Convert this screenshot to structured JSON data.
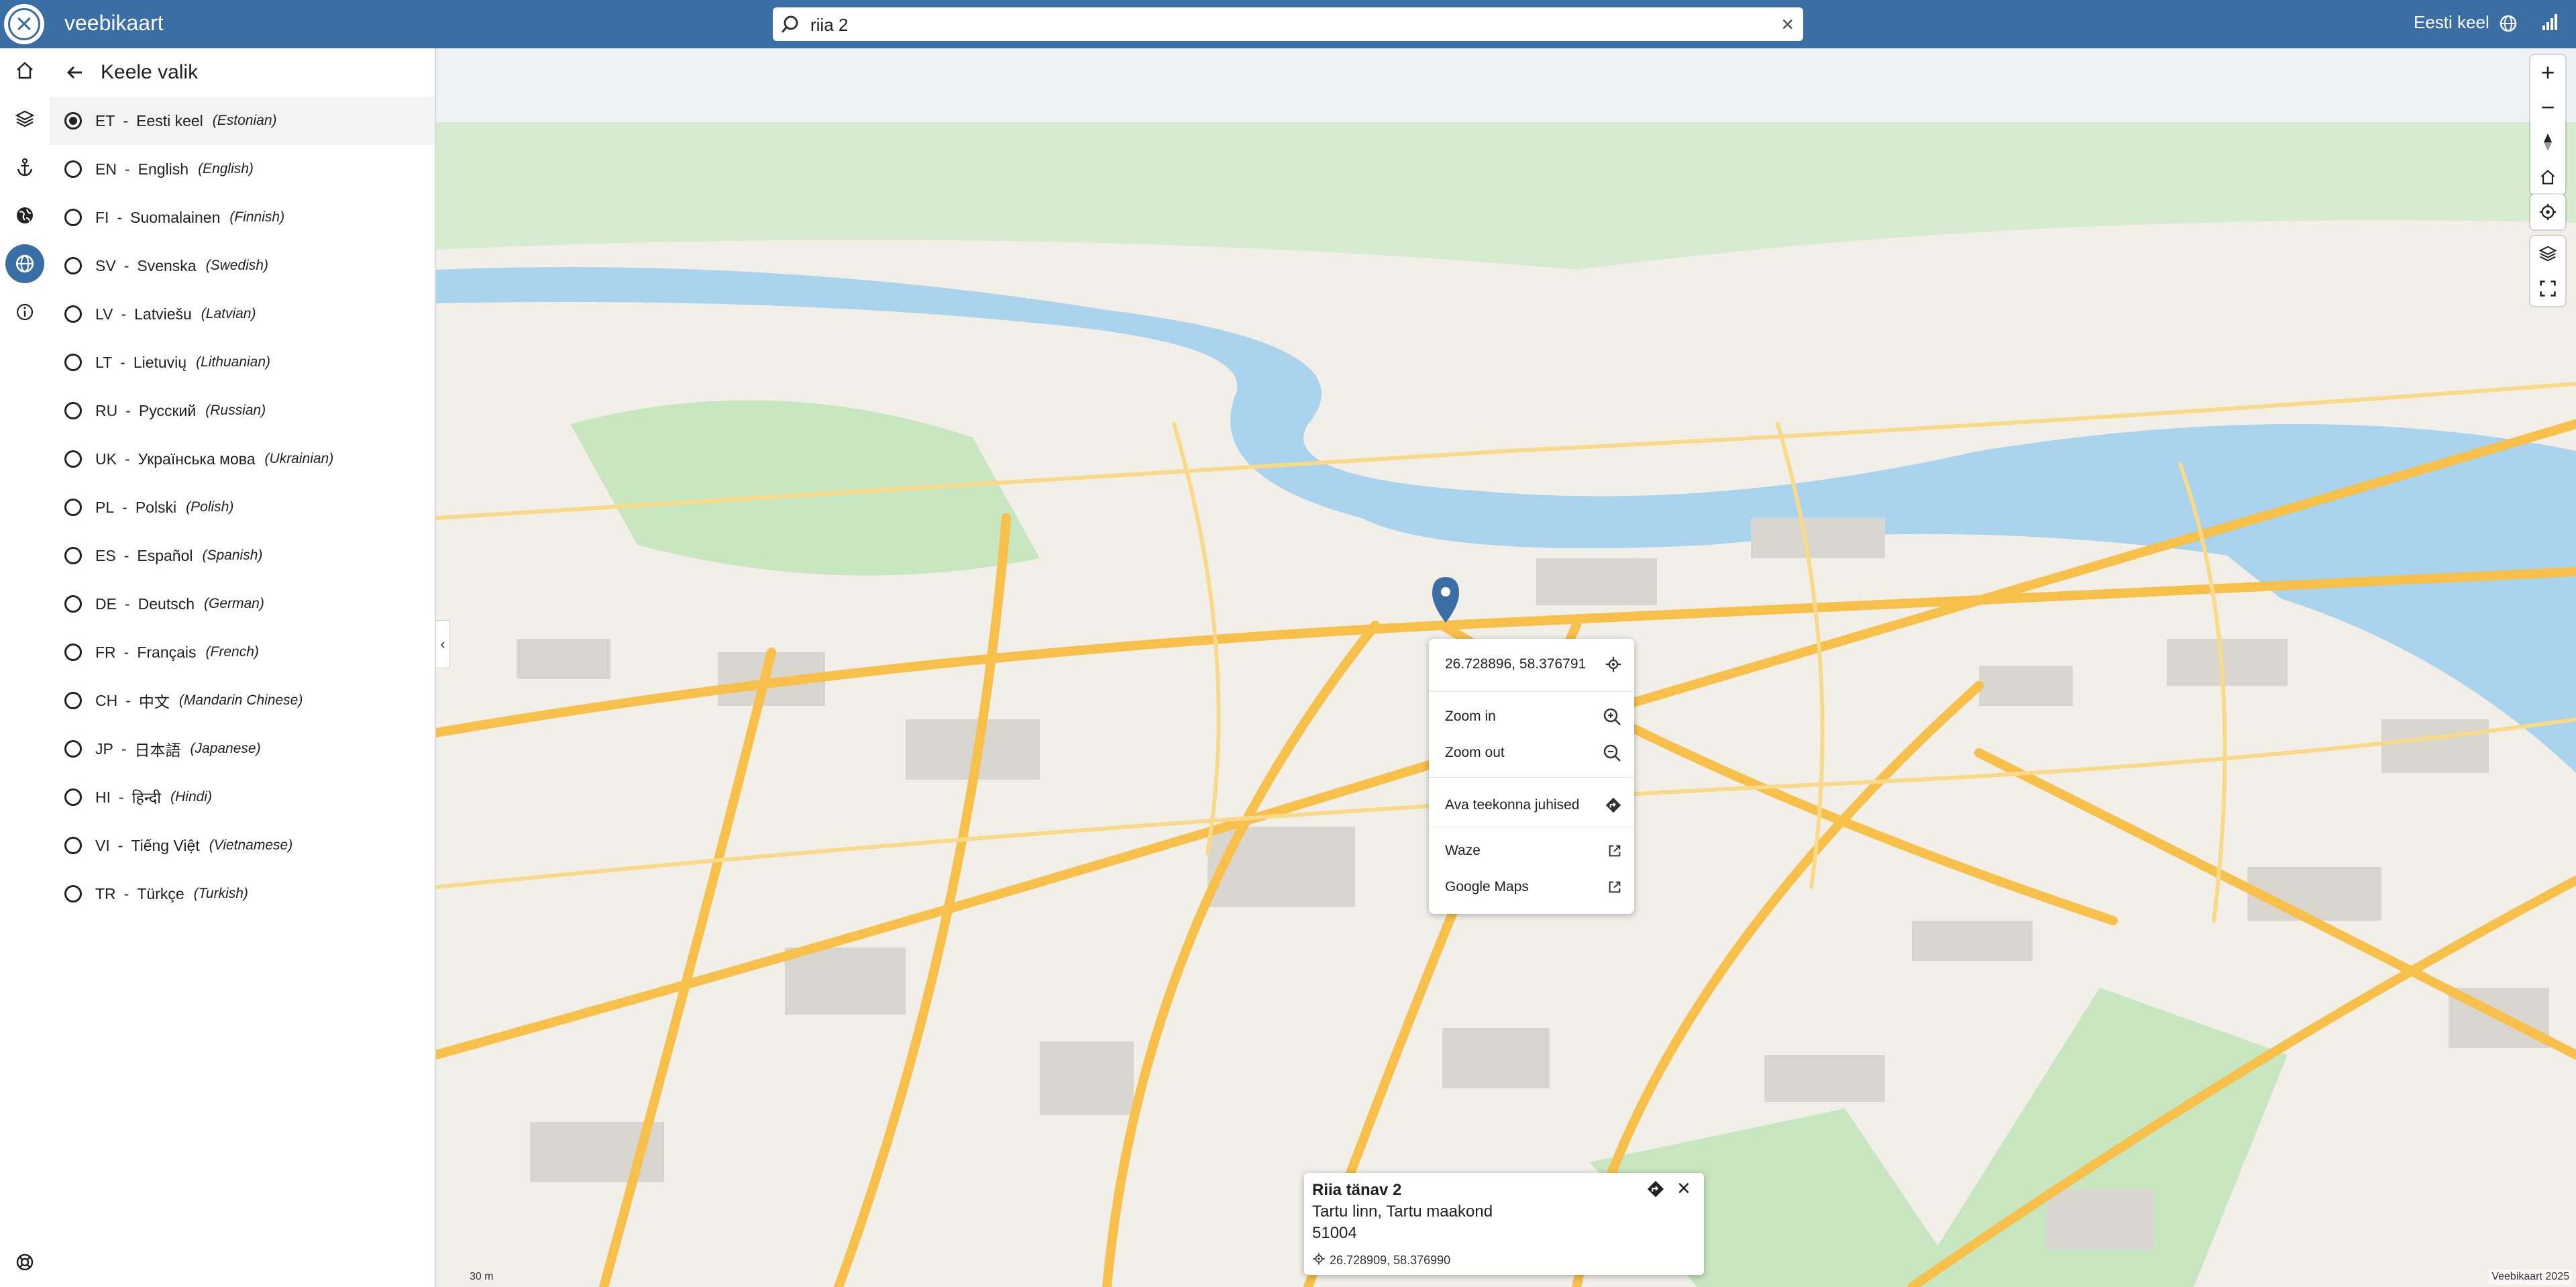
{
  "app": {
    "title": "veebikaart",
    "attribution": "Veebikaart 2025",
    "scale": "30 m"
  },
  "search": {
    "value": "riia 2",
    "placeholder": ""
  },
  "header": {
    "language": "Eesti keel"
  },
  "panel": {
    "title": "Keele valik",
    "languages": [
      {
        "code": "ET",
        "native": "Eesti keel",
        "english": "(Estonian)",
        "selected": true
      },
      {
        "code": "EN",
        "native": "English",
        "english": "(English)"
      },
      {
        "code": "FI",
        "native": "Suomalainen",
        "english": "(Finnish)"
      },
      {
        "code": "SV",
        "native": "Svenska",
        "english": "(Swedish)"
      },
      {
        "code": "LV",
        "native": "Latviešu",
        "english": "(Latvian)"
      },
      {
        "code": "LT",
        "native": "Lietuvių",
        "english": "(Lithuanian)"
      },
      {
        "code": "RU",
        "native": "Русский",
        "english": "(Russian)"
      },
      {
        "code": "UK",
        "native": "Українська мова",
        "english": "(Ukrainian)"
      },
      {
        "code": "PL",
        "native": "Polski",
        "english": "(Polish)"
      },
      {
        "code": "ES",
        "native": "Español",
        "english": "(Spanish)"
      },
      {
        "code": "DE",
        "native": "Deutsch",
        "english": "(German)"
      },
      {
        "code": "FR",
        "native": "Français",
        "english": "(French)"
      },
      {
        "code": "CH",
        "native": "中文",
        "english": "(Mandarin Chinese)"
      },
      {
        "code": "JP",
        "native": "日本語",
        "english": "(Japanese)"
      },
      {
        "code": "HI",
        "native": "हिन्दी",
        "english": "(Hindi)"
      },
      {
        "code": "VI",
        "native": "Tiếng Việt",
        "english": "(Vietnamese)"
      },
      {
        "code": "TR",
        "native": "Türkçe",
        "english": "(Turkish)"
      }
    ]
  },
  "context_menu": {
    "coords": "26.728896, 58.376791",
    "zoom_in": "Zoom in",
    "zoom_out": "Zoom out",
    "directions": "Ava teekonna juhised",
    "waze": "Waze",
    "google_maps": "Google Maps"
  },
  "info_card": {
    "name": "Riia tänav 2",
    "line1": "Tartu linn, Tartu maakond",
    "line2": "51004",
    "coords": "26.728909, 58.376990"
  },
  "colors": {
    "brand": "#3a6ea5",
    "road": "#f6c04b",
    "water": "#aad3ee",
    "park": "#c8e6c0",
    "building": "#d9d5cf"
  },
  "icons": [
    "close-icon",
    "search-icon",
    "globe-icon",
    "signal-icon",
    "home-icon",
    "layers-icon",
    "anchor-icon",
    "globe-alt-icon",
    "info-icon",
    "lifebuoy-icon",
    "back-arrow-icon",
    "map-pin-icon"
  ]
}
